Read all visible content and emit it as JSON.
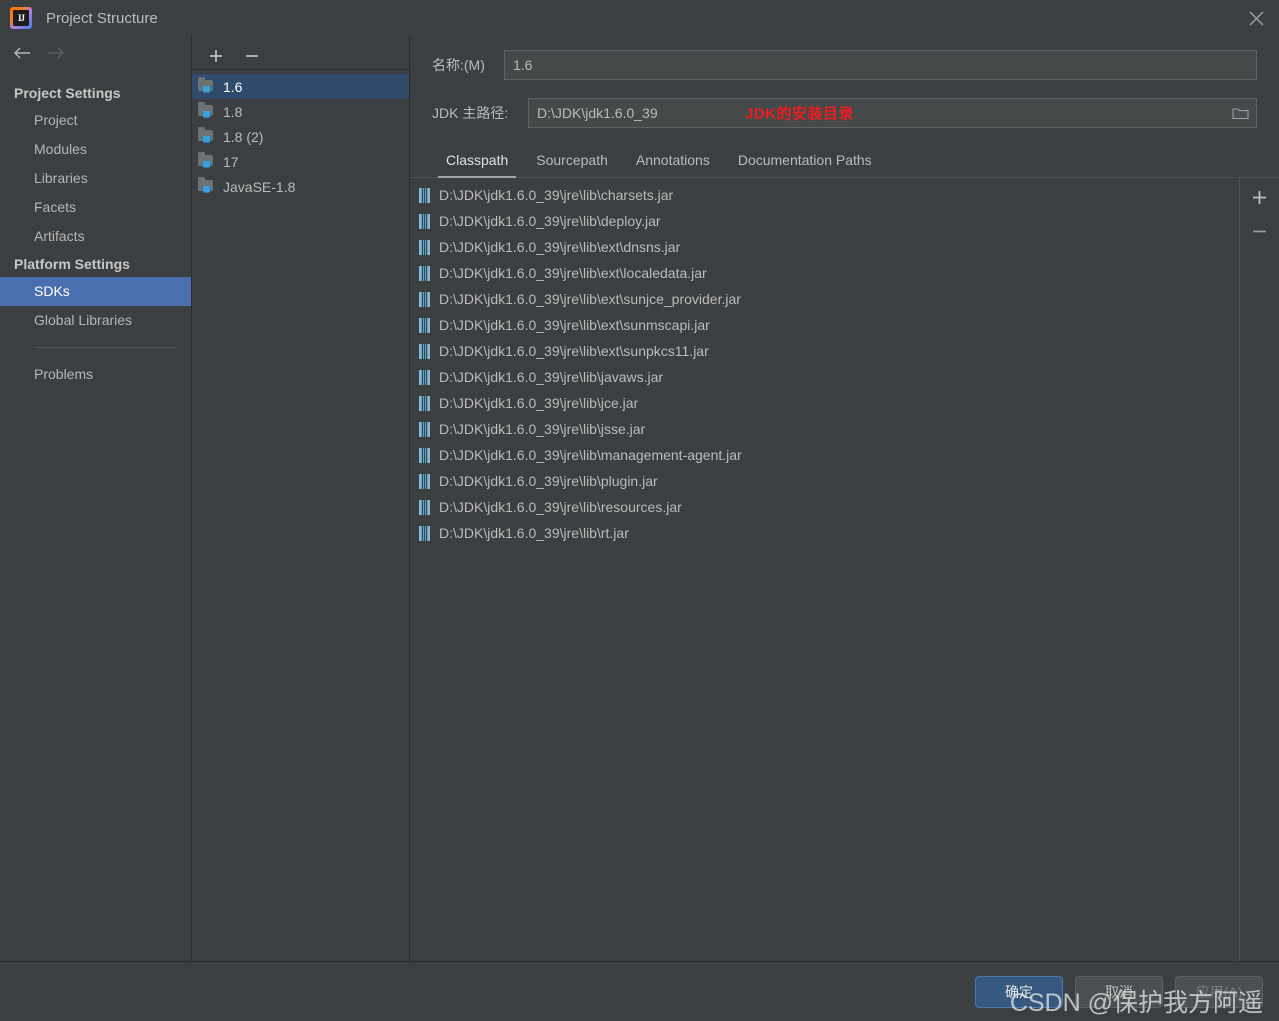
{
  "window": {
    "title": "Project Structure",
    "logo_text": "IJ",
    "close_icon": "close-icon"
  },
  "nav": {
    "back_icon": "arrow-left-icon",
    "forward_icon": "arrow-right-icon"
  },
  "sidebar": {
    "groups": [
      {
        "label": "Project Settings",
        "items": [
          {
            "label": "Project",
            "selected": false
          },
          {
            "label": "Modules",
            "selected": false
          },
          {
            "label": "Libraries",
            "selected": false
          },
          {
            "label": "Facets",
            "selected": false
          },
          {
            "label": "Artifacts",
            "selected": false
          }
        ]
      },
      {
        "label": "Platform Settings",
        "items": [
          {
            "label": "SDKs",
            "selected": true
          },
          {
            "label": "Global Libraries",
            "selected": false
          }
        ]
      }
    ],
    "problems_label": "Problems"
  },
  "sdk_panel": {
    "add_icon": "plus-icon",
    "remove_icon": "minus-icon",
    "items": [
      {
        "label": "1.6",
        "selected": true
      },
      {
        "label": "1.8",
        "selected": false
      },
      {
        "label": "1.8 (2)",
        "selected": false
      },
      {
        "label": "17",
        "selected": false
      },
      {
        "label": "JavaSE-1.8",
        "selected": false
      }
    ]
  },
  "details": {
    "name_label": "名称:(M)",
    "name_value": "1.6",
    "path_label": "JDK 主路径:",
    "path_value": "D:\\JDK\\jdk1.6.0_39",
    "path_annotation": "JDK的安装目录",
    "annotation_color": "#ee1c1c",
    "browse_icon": "folder-icon",
    "tabs": [
      {
        "label": "Classpath",
        "active": true
      },
      {
        "label": "Sourcepath",
        "active": false
      },
      {
        "label": "Annotations",
        "active": false
      },
      {
        "label": "Documentation Paths",
        "active": false
      }
    ]
  },
  "classpath": {
    "add_icon": "plus-icon",
    "remove_icon": "minus-icon",
    "entries": [
      "D:\\JDK\\jdk1.6.0_39\\jre\\lib\\charsets.jar",
      "D:\\JDK\\jdk1.6.0_39\\jre\\lib\\deploy.jar",
      "D:\\JDK\\jdk1.6.0_39\\jre\\lib\\ext\\dnsns.jar",
      "D:\\JDK\\jdk1.6.0_39\\jre\\lib\\ext\\localedata.jar",
      "D:\\JDK\\jdk1.6.0_39\\jre\\lib\\ext\\sunjce_provider.jar",
      "D:\\JDK\\jdk1.6.0_39\\jre\\lib\\ext\\sunmscapi.jar",
      "D:\\JDK\\jdk1.6.0_39\\jre\\lib\\ext\\sunpkcs11.jar",
      "D:\\JDK\\jdk1.6.0_39\\jre\\lib\\javaws.jar",
      "D:\\JDK\\jdk1.6.0_39\\jre\\lib\\jce.jar",
      "D:\\JDK\\jdk1.6.0_39\\jre\\lib\\jsse.jar",
      "D:\\JDK\\jdk1.6.0_39\\jre\\lib\\management-agent.jar",
      "D:\\JDK\\jdk1.6.0_39\\jre\\lib\\plugin.jar",
      "D:\\JDK\\jdk1.6.0_39\\jre\\lib\\resources.jar",
      "D:\\JDK\\jdk1.6.0_39\\jre\\lib\\rt.jar"
    ]
  },
  "footer": {
    "ok_label": "确定",
    "cancel_label": "取消",
    "apply_label": "应用(A)",
    "watermark": "CSDN @保护我方阿遥"
  },
  "colors": {
    "background": "#3c3f41",
    "selection_blue": "#4b6eaf",
    "list_selection": "#2f4a6b",
    "primary_button": "#365880"
  }
}
